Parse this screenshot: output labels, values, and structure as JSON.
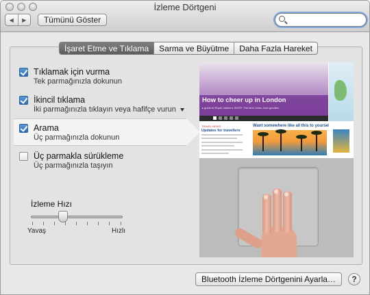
{
  "window": {
    "title": "İzleme Dörtgeni",
    "show_all": "Tümünü Göster",
    "nav_back": "◀",
    "nav_forward": "▶",
    "search_value": ""
  },
  "tabs": [
    {
      "label": "İşaret Etme ve Tıklama",
      "active": true
    },
    {
      "label": "Sarma ve Büyütme",
      "active": false
    },
    {
      "label": "Daha Fazla Hareket",
      "active": false
    }
  ],
  "options": [
    {
      "title": "Tıklamak için vurma",
      "subtitle": "Tek parmağınızla dokunun",
      "checked": true
    },
    {
      "title": "İkincil tıklama",
      "subtitle": "İki parmağınızla tıklayın veya hafifçe vurun",
      "checked": true,
      "has_menu": true
    },
    {
      "title": "Arama",
      "subtitle": "Üç parmağınızla dokunun",
      "checked": true,
      "selected": true
    },
    {
      "title": "Üç parmakla sürükleme",
      "subtitle": "Üç parmağınızla taşıyın",
      "checked": false
    }
  ],
  "tracking_speed": {
    "label": "İzleme Hızı",
    "min_label": "Yavaş",
    "max_label": "Hızlı",
    "value_fraction": 0.33
  },
  "preview": {
    "hero_title": "How to cheer up in London",
    "hero_caption": "▸ guide to Royal Jubilee   ▸ SHOP: The best Union Jack goodies",
    "news_kicker": "TRAVEL NEWS",
    "news_heading": "Updates for travellers",
    "promo_heading": "Want somewhere like all this to yourself?",
    "pager": [
      "1",
      "2",
      "3",
      "4",
      "5"
    ]
  },
  "footer": {
    "bluetooth_button": "Bluetooth İzleme Dörtgenini Ayarla…",
    "help": "?"
  },
  "colors": {
    "checkbox_on": "#2d6bb3",
    "tab_active": "#6a6a6a",
    "hero_purple": "#8e5aa8"
  }
}
